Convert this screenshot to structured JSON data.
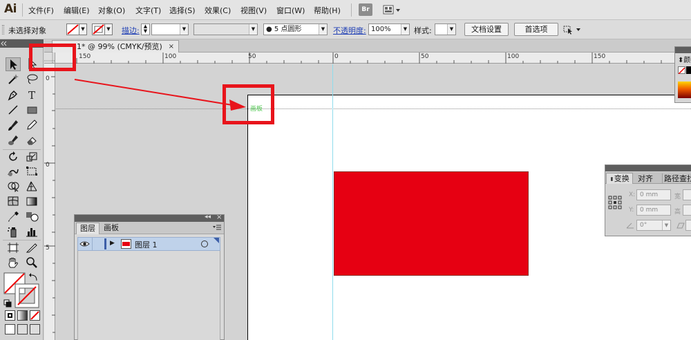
{
  "app": {
    "logo": "Ai",
    "bridge_label": "Br"
  },
  "menu": {
    "items": [
      {
        "label": "文件(F)"
      },
      {
        "label": "编辑(E)"
      },
      {
        "label": "对象(O)"
      },
      {
        "label": "文字(T)"
      },
      {
        "label": "选择(S)"
      },
      {
        "label": "效果(C)"
      },
      {
        "label": "视图(V)"
      },
      {
        "label": "窗口(W)"
      },
      {
        "label": "帮助(H)"
      }
    ]
  },
  "control_bar": {
    "selection_status": "未选择对象",
    "stroke_label": "描边:",
    "brush_value": "5 点圆形",
    "opacity_label": "不透明度:",
    "opacity_value": "100%",
    "style_label": "样式:",
    "doc_setup_button": "文档设置",
    "preferences_button": "首选项"
  },
  "document": {
    "tab_title": "1* @ 99% (CMYK/预览)",
    "tab_close": "×",
    "artboard_label": "画板",
    "top_ruler_labels": [
      "150",
      "100",
      "50",
      "0",
      "50",
      "100",
      "150"
    ],
    "left_ruler_labels": [
      "0",
      "0",
      "5"
    ]
  },
  "layers_panel": {
    "tabs": [
      "图层",
      "画板"
    ],
    "layers": [
      {
        "name": "图层 1"
      }
    ]
  },
  "color_panel": {
    "title": "颜"
  },
  "transform_panel": {
    "tabs": [
      "变换",
      "对齐",
      "路径查找"
    ],
    "x_label": "X:",
    "x_value": "0 mm",
    "y_label": "Y:",
    "y_value": "0 mm",
    "w_label": "宽",
    "h_label": "高",
    "angle_value": "0°"
  },
  "colors": {
    "selected_rect_fill": "#e60012",
    "highlight": "#e8141b",
    "artboard_label_color": "#55c855",
    "guide_color": "#8fdcec",
    "layer_color": "#e60012"
  }
}
